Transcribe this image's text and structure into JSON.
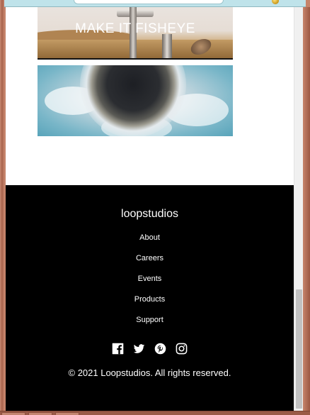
{
  "gallery": {
    "cards": [
      {
        "caption": "MAKE IT FISHEYE"
      },
      {
        "caption": ""
      }
    ]
  },
  "footer": {
    "brand": "loopstudios",
    "nav": [
      "About",
      "Careers",
      "Events",
      "Products",
      "Support"
    ],
    "social_icons": [
      "facebook-icon",
      "twitter-icon",
      "pinterest-icon",
      "instagram-icon"
    ],
    "copyright": "© 2021 Loopstudios. All rights reserved."
  },
  "colors": {
    "footer_bg": "#000000",
    "page_bg": "#ffffff",
    "window_frame": "#b8725c",
    "address_bar": "#bfe3ea"
  }
}
